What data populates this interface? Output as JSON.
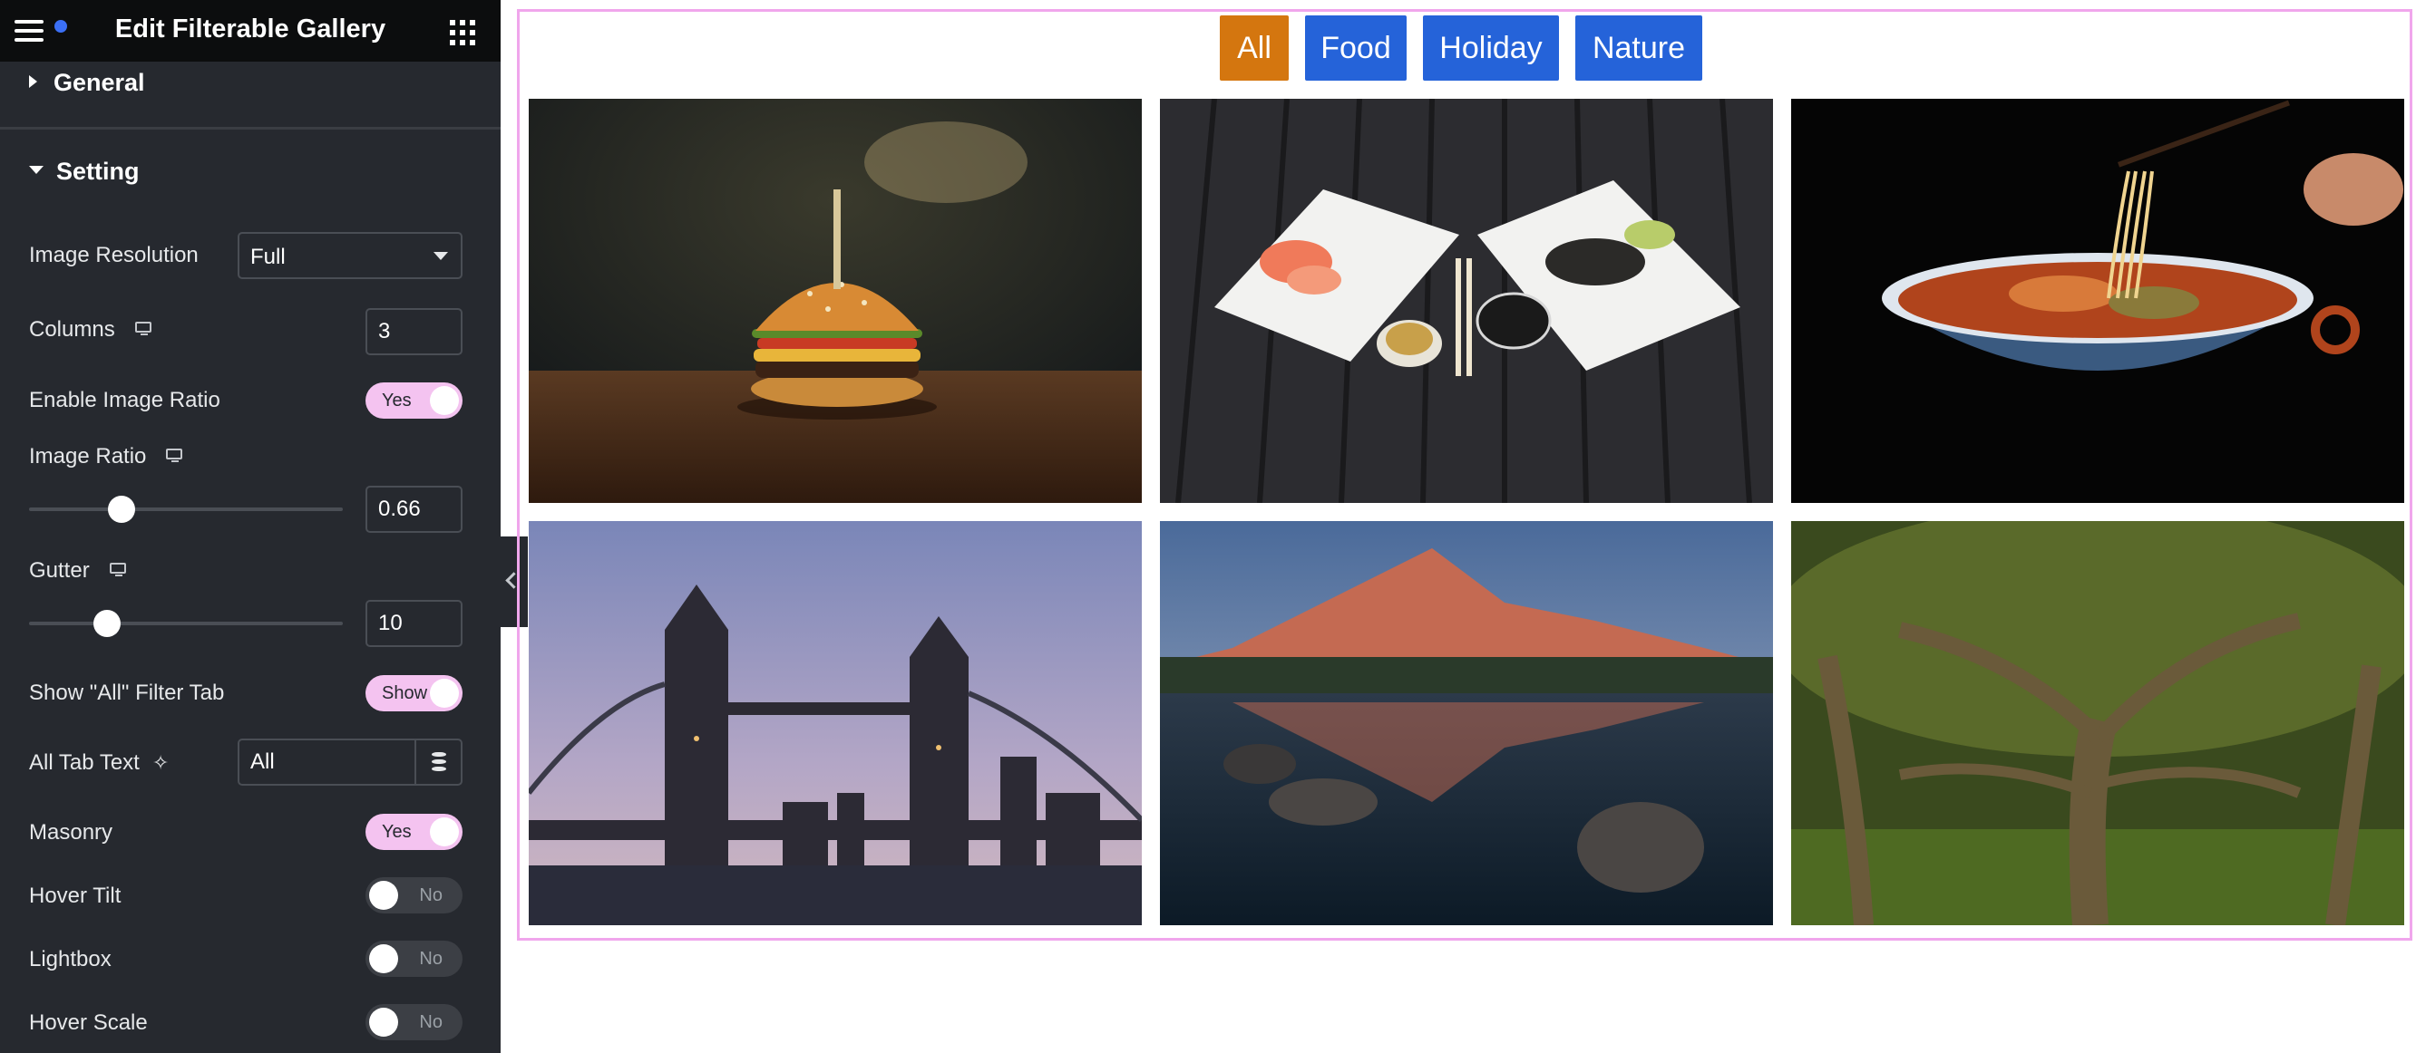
{
  "header": {
    "title": "Edit Filterable Gallery"
  },
  "sections": {
    "general": "General",
    "setting": "Setting"
  },
  "controls": {
    "image_resolution": {
      "label": "Image Resolution",
      "value": "Full"
    },
    "columns": {
      "label": "Columns",
      "value": "3"
    },
    "enable_image_ratio": {
      "label": "Enable Image Ratio",
      "state": "Yes"
    },
    "image_ratio": {
      "label": "Image Ratio",
      "value": "0.66"
    },
    "gutter": {
      "label": "Gutter",
      "value": "10"
    },
    "show_all_tab": {
      "label": "Show \"All\" Filter Tab",
      "state": "Show"
    },
    "all_tab_text": {
      "label": "All Tab Text",
      "value": "All"
    },
    "masonry": {
      "label": "Masonry",
      "state": "Yes"
    },
    "hover_tilt": {
      "label": "Hover Tilt",
      "state": "No"
    },
    "lightbox": {
      "label": "Lightbox",
      "state": "No"
    },
    "hover_scale": {
      "label": "Hover Scale",
      "state": "No"
    }
  },
  "filters": [
    {
      "label": "All",
      "active": true
    },
    {
      "label": "Food",
      "active": false
    },
    {
      "label": "Holiday",
      "active": false
    },
    {
      "label": "Nature",
      "active": false
    }
  ],
  "colors": {
    "sidebar_bg": "#26292f",
    "toggle_on": "#f4c3f0",
    "filter_active": "#d4760f",
    "filter_inactive": "#2563d9",
    "preview_border": "#f0a6ec"
  },
  "gallery_images": [
    "burger",
    "sashimi",
    "noodles",
    "tower-bridge",
    "mountain-lake",
    "forest-tree"
  ]
}
